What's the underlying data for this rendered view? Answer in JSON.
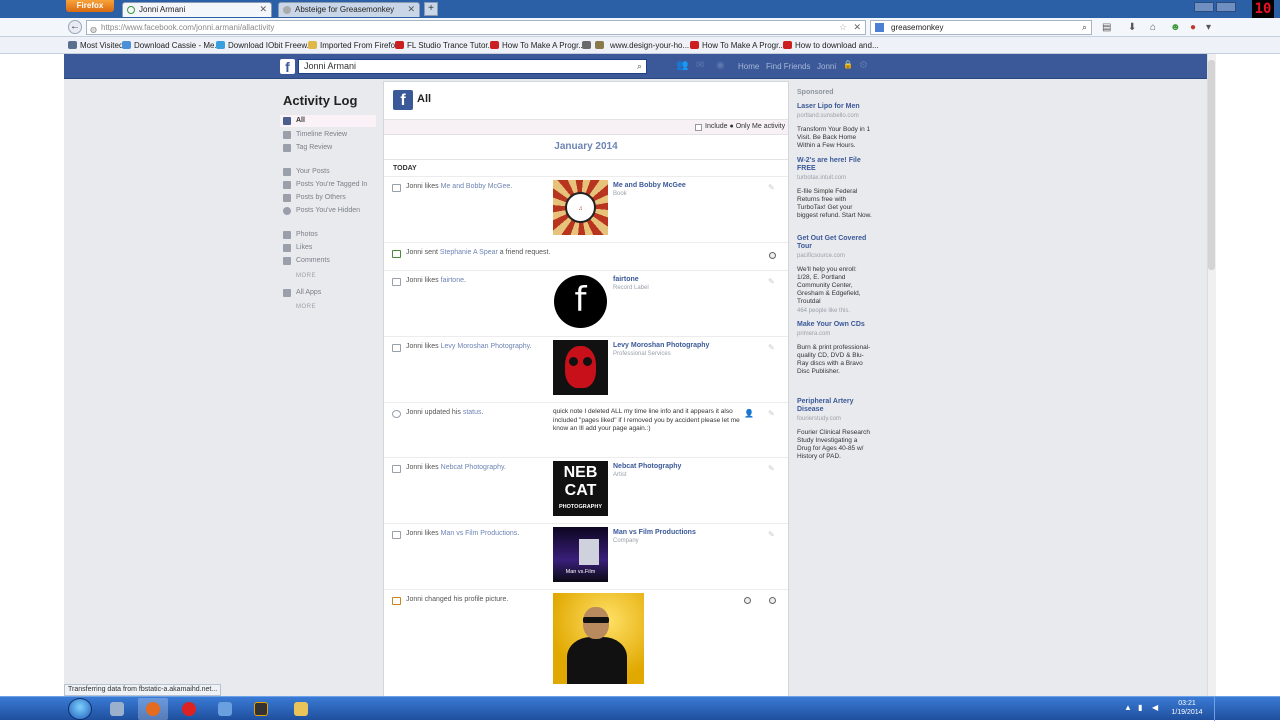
{
  "browser": {
    "menu_label": "Firefox",
    "tabs": [
      {
        "title": "Jonni Armani",
        "active": true
      },
      {
        "title": "Absteige for Greasemonkey",
        "active": false
      }
    ],
    "url": "https://www.facebook.com/jonni.armani/allactivity",
    "search_value": "greasemonkey",
    "bookmarks": [
      {
        "label": "Most Visited",
        "color": "#5a6f8f"
      },
      {
        "label": "Download Cassie - Me...",
        "color": "#4a90d9"
      },
      {
        "label": "Download IObit Freew...",
        "color": "#3aa0dd"
      },
      {
        "label": "Imported From Firefox",
        "color": "#e0b84a"
      },
      {
        "label": "FL Studio Trance Tutor...",
        "color": "#cc1f1f"
      },
      {
        "label": "How To Make A Progr...",
        "color": "#cc1f1f"
      },
      {
        "label": "www.design-your-ho...",
        "color": "#6a6a6a"
      },
      {
        "label": "How To Make A Progr...",
        "color": "#cc1f1f"
      },
      {
        "label": "How to download and...",
        "color": "#cc1f1f"
      }
    ],
    "status_text": "Transferring data from fbstatic-a.akamaihd.net..."
  },
  "fb_header": {
    "logo": "f",
    "search_value": "Jonni Armani",
    "nav": [
      "Home",
      "Find Friends",
      "Jonni"
    ]
  },
  "left_nav": {
    "title": "Activity Log",
    "group1": [
      "All",
      "Timeline Review",
      "Tag Review"
    ],
    "group2": [
      "Your Posts",
      "Posts You're Tagged In",
      "Posts by Others",
      "Posts You've Hidden"
    ],
    "group3": [
      "Photos",
      "Likes",
      "Comments"
    ],
    "more1": "MORE",
    "group4": [
      "All Apps"
    ],
    "more2": "MORE"
  },
  "main": {
    "header": "All",
    "include_label": "Include ● Only Me activity",
    "month": "January 2014",
    "today": "TODAY",
    "rows": [
      {
        "actor": "Jonni likes ",
        "object": "Me and Bobby McGee",
        "end": ".",
        "page_name": "Me and Bobby McGee",
        "page_cat": "Book"
      },
      {
        "actor": "Jonni sent ",
        "object": "Stephanie A Spear",
        "end": " a friend request."
      },
      {
        "actor": "Jonni likes ",
        "object": "fairtone",
        "end": ".",
        "page_name": "fairtone",
        "page_cat": "Record Label"
      },
      {
        "actor": "Jonni likes ",
        "object": "Levy Moroshan Photography",
        "end": ".",
        "page_name": "Levy Moroshan Photography",
        "page_cat": "Professional Services"
      },
      {
        "actor": "Jonni updated his ",
        "object": "status",
        "end": ".",
        "status_text": "quick note I deleted ALL my time line info and it appears it also included \"pages liked\" if I removed you by accident please let me know an Ill add your page again.:)",
        "status_end": ":)"
      },
      {
        "actor": "Jonni likes ",
        "object": "Nebcat Photography",
        "end": ".",
        "page_name": "Nebcat Photography",
        "page_cat": "Artist",
        "thumb_l1": "NEB",
        "thumb_l2": "CAT",
        "thumb_l3": "PHOTOGRAPHY"
      },
      {
        "actor": "Jonni likes ",
        "object": "Man vs Film Productions",
        "end": ".",
        "page_name": "Man vs Film Productions",
        "page_cat": "Company",
        "thumb_caption": "Man vs.Film"
      },
      {
        "actor": "Jonni changed his profile picture.",
        "object": "",
        "end": ""
      }
    ]
  },
  "sponsored": {
    "title": "Sponsored",
    "ads": [
      {
        "title": "Laser Lipo for Men",
        "url": "portland.sunsbello.com",
        "body": "Transform Your Body in 1 Visit. Be Back Home Within a Few Hours."
      },
      {
        "title": "W-2's are here! File FREE",
        "url": "turbotax.intuit.com",
        "body": "E-file Simple Federal Returns free with TurboTax! Get your biggest refund. Start Now."
      },
      {
        "title": "Get Out Get Covered Tour",
        "url": "pacificsource.com",
        "body": "We'll help you enroll: 1/28, E. Portland Community Center, Gresham & Edgefield, Troutdal",
        "likes": "464 people like this."
      },
      {
        "title": "Make Your Own CDs",
        "url": "primera.com",
        "body": "Burn & print professional-quality CD, DVD & Blu-Ray discs with a Bravo Disc Publisher."
      },
      {
        "title": "Peripheral Artery Disease",
        "url": "fourierstudy.com",
        "body": "Fourier Clinical Research Study Investigating a Drug for Ages 40-85 w/ History of PAD."
      }
    ]
  },
  "taskbar": {
    "time": "03:21",
    "date": "1/19/2014",
    "counter": "10"
  }
}
